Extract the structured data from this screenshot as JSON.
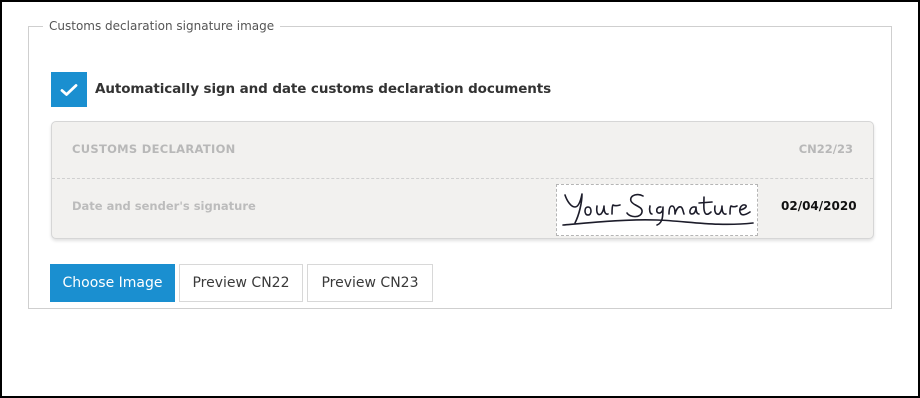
{
  "section": {
    "legend": "Customs declaration signature image"
  },
  "auto_sign": {
    "checked": true,
    "label": "Automatically sign and date customs declaration documents"
  },
  "preview_card": {
    "title": "CUSTOMS DECLARATION",
    "code": "CN22/23",
    "signature_label": "Date and sender's signature",
    "signature_text": "Your Signature",
    "date": "02/04/2020"
  },
  "buttons": {
    "choose_image": "Choose Image",
    "preview_cn22": "Preview CN22",
    "preview_cn23": "Preview CN23"
  },
  "colors": {
    "accent": "#1a8fd0"
  }
}
